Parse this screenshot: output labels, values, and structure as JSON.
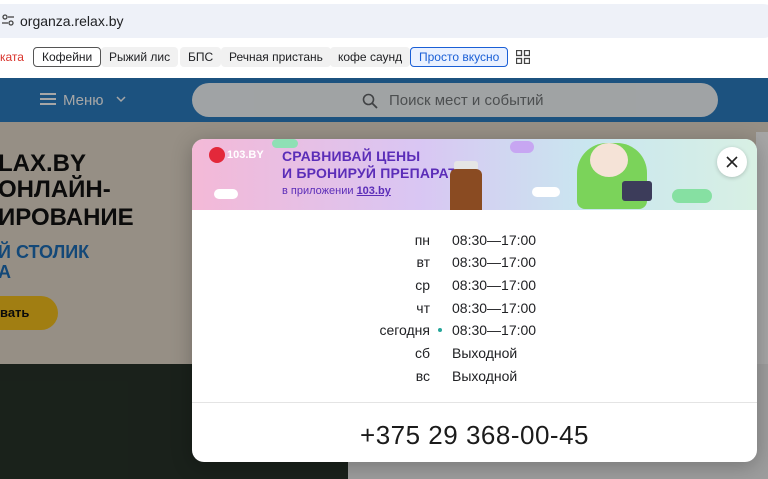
{
  "browser": {
    "url": "organza.relax.by"
  },
  "chips": [
    {
      "label": "ката",
      "style": "red"
    },
    {
      "label": "Кофейни",
      "style": "outlined"
    },
    {
      "label": "Рыжий лис",
      "style": "plain"
    },
    {
      "label": "БПС",
      "style": "plain"
    },
    {
      "label": "Речная пристань",
      "style": "plain"
    },
    {
      "label": "кофе саунд",
      "style": "plain"
    },
    {
      "label": "Просто вкусно",
      "style": "blue"
    }
  ],
  "site_header": {
    "menu_label": "Меню",
    "search_placeholder": "Поиск мест и событий"
  },
  "background": {
    "line1": "LAX.BY",
    "line2": "ОНЛАЙН-",
    "line3": "ИРОВАНИЕ",
    "line4": "Й СТОЛИК",
    "line5": "А",
    "cta_label": "вать"
  },
  "modal": {
    "ad": {
      "logo": "103.BY",
      "headline_1": "СРАВНИВАЙ ЦЕНЫ",
      "headline_2": "И БРОНИРУЙ ПРЕПАРАТЫ",
      "sub_prefix": "в приложении ",
      "sub_link": "103.by"
    },
    "schedule": [
      {
        "day": "пн",
        "time": "08:30—17:00",
        "today": false
      },
      {
        "day": "вт",
        "time": "08:30—17:00",
        "today": false
      },
      {
        "day": "ср",
        "time": "08:30—17:00",
        "today": false
      },
      {
        "day": "чт",
        "time": "08:30—17:00",
        "today": false
      },
      {
        "day": "сегодня",
        "time": "08:30—17:00",
        "today": true
      },
      {
        "day": "сб",
        "time": "Выходной",
        "today": false
      },
      {
        "day": "вс",
        "time": "Выходной",
        "today": false
      }
    ],
    "phone": "+375 29 368-00-45"
  },
  "colors": {
    "header_blue": "#2b7fc4",
    "today_dot": "#26a69a",
    "chip_blue": "#1a5fd6",
    "ad_purple": "#5b2db8"
  }
}
